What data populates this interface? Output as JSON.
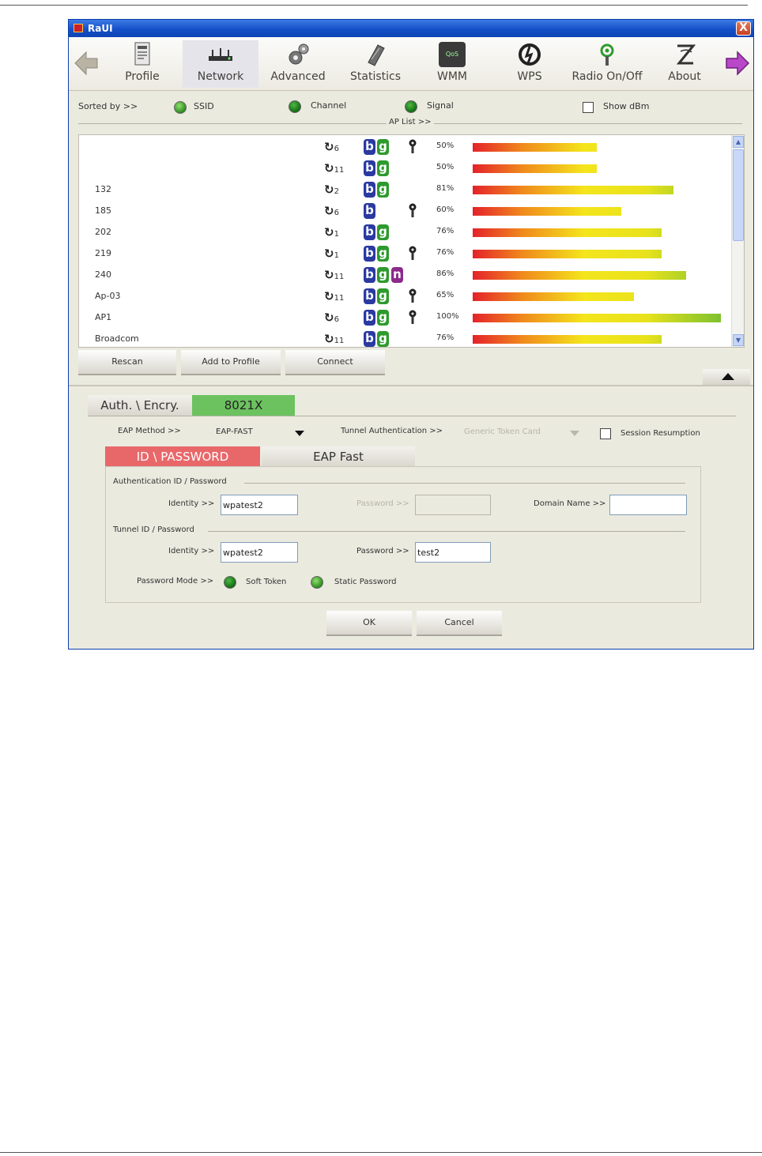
{
  "window": {
    "title": "RaUI",
    "close_label": "X"
  },
  "toolbar": {
    "items": [
      {
        "label": "Profile",
        "icon": "profile-icon"
      },
      {
        "label": "Network",
        "icon": "network-icon"
      },
      {
        "label": "Advanced",
        "icon": "advanced-icon"
      },
      {
        "label": "Statistics",
        "icon": "statistics-icon"
      },
      {
        "label": "WMM",
        "icon": "wmm-icon",
        "icon_text": "QoS"
      },
      {
        "label": "WPS",
        "icon": "wps-icon"
      },
      {
        "label": "Radio On/Off",
        "icon": "radio-icon"
      },
      {
        "label": "About",
        "icon": "about-icon"
      }
    ],
    "active": "Network"
  },
  "sort": {
    "label": "Sorted by >>",
    "options": [
      "SSID",
      "Channel",
      "Signal"
    ],
    "show_dbm": "Show dBm",
    "ap_list_label": "AP List >>"
  },
  "ap_list": [
    {
      "ssid": "",
      "channel": "6",
      "modes": [
        "b",
        "g"
      ],
      "secure": true,
      "signal": 50
    },
    {
      "ssid": "",
      "channel": "11",
      "modes": [
        "b",
        "g"
      ],
      "secure": false,
      "signal": 50
    },
    {
      "ssid": "132",
      "channel": "2",
      "modes": [
        "b",
        "g"
      ],
      "secure": false,
      "signal": 81
    },
    {
      "ssid": "185",
      "channel": "6",
      "modes": [
        "b"
      ],
      "secure": true,
      "signal": 60
    },
    {
      "ssid": "202",
      "channel": "1",
      "modes": [
        "b",
        "g"
      ],
      "secure": false,
      "signal": 76
    },
    {
      "ssid": "219",
      "channel": "1",
      "modes": [
        "b",
        "g"
      ],
      "secure": true,
      "signal": 76
    },
    {
      "ssid": "240",
      "channel": "11",
      "modes": [
        "b",
        "g",
        "n"
      ],
      "secure": false,
      "signal": 86
    },
    {
      "ssid": "Ap-03",
      "channel": "11",
      "modes": [
        "b",
        "g"
      ],
      "secure": true,
      "signal": 65
    },
    {
      "ssid": "AP1",
      "channel": "6",
      "modes": [
        "b",
        "g"
      ],
      "secure": true,
      "signal": 100
    },
    {
      "ssid": "Broadcom",
      "channel": "11",
      "modes": [
        "b",
        "g"
      ],
      "secure": false,
      "signal": 76
    }
  ],
  "signal_suffix": "%",
  "buttons": {
    "rescan": "Rescan",
    "add_to_profile": "Add to Profile",
    "connect": "Connect",
    "ok": "OK",
    "cancel": "Cancel"
  },
  "auth": {
    "tab_label": "Auth. \\ Encry.",
    "tab_value": "8021X"
  },
  "eap": {
    "method_label": "EAP Method >>",
    "method_value": "EAP-FAST",
    "tunnel_auth_label": "Tunnel Authentication >>",
    "tunnel_auth_value": "Generic Token Card",
    "session_resumption": "Session Resumption"
  },
  "subtabs": {
    "id_password": "ID \\ PASSWORD",
    "eap_fast": "EAP Fast"
  },
  "auth_group": {
    "title": "Authentication ID / Password",
    "identity_label": "Identity >>",
    "identity_value": "wpatest2",
    "password_label": "Password >>",
    "password_value": "",
    "domain_label": "Domain Name >>",
    "domain_value": ""
  },
  "tunnel_group": {
    "title": "Tunnel ID / Password",
    "identity_label": "Identity >>",
    "identity_value": "wpatest2",
    "password_label": "Password >>",
    "password_value": "test2"
  },
  "password_mode": {
    "label": "Password Mode >>",
    "options": [
      "Soft Token",
      "Static Password"
    ]
  },
  "colors": {
    "active_tab": "#e8686a",
    "auth_value_bg": "#6cc25f",
    "title_bar": "#1550c8"
  }
}
